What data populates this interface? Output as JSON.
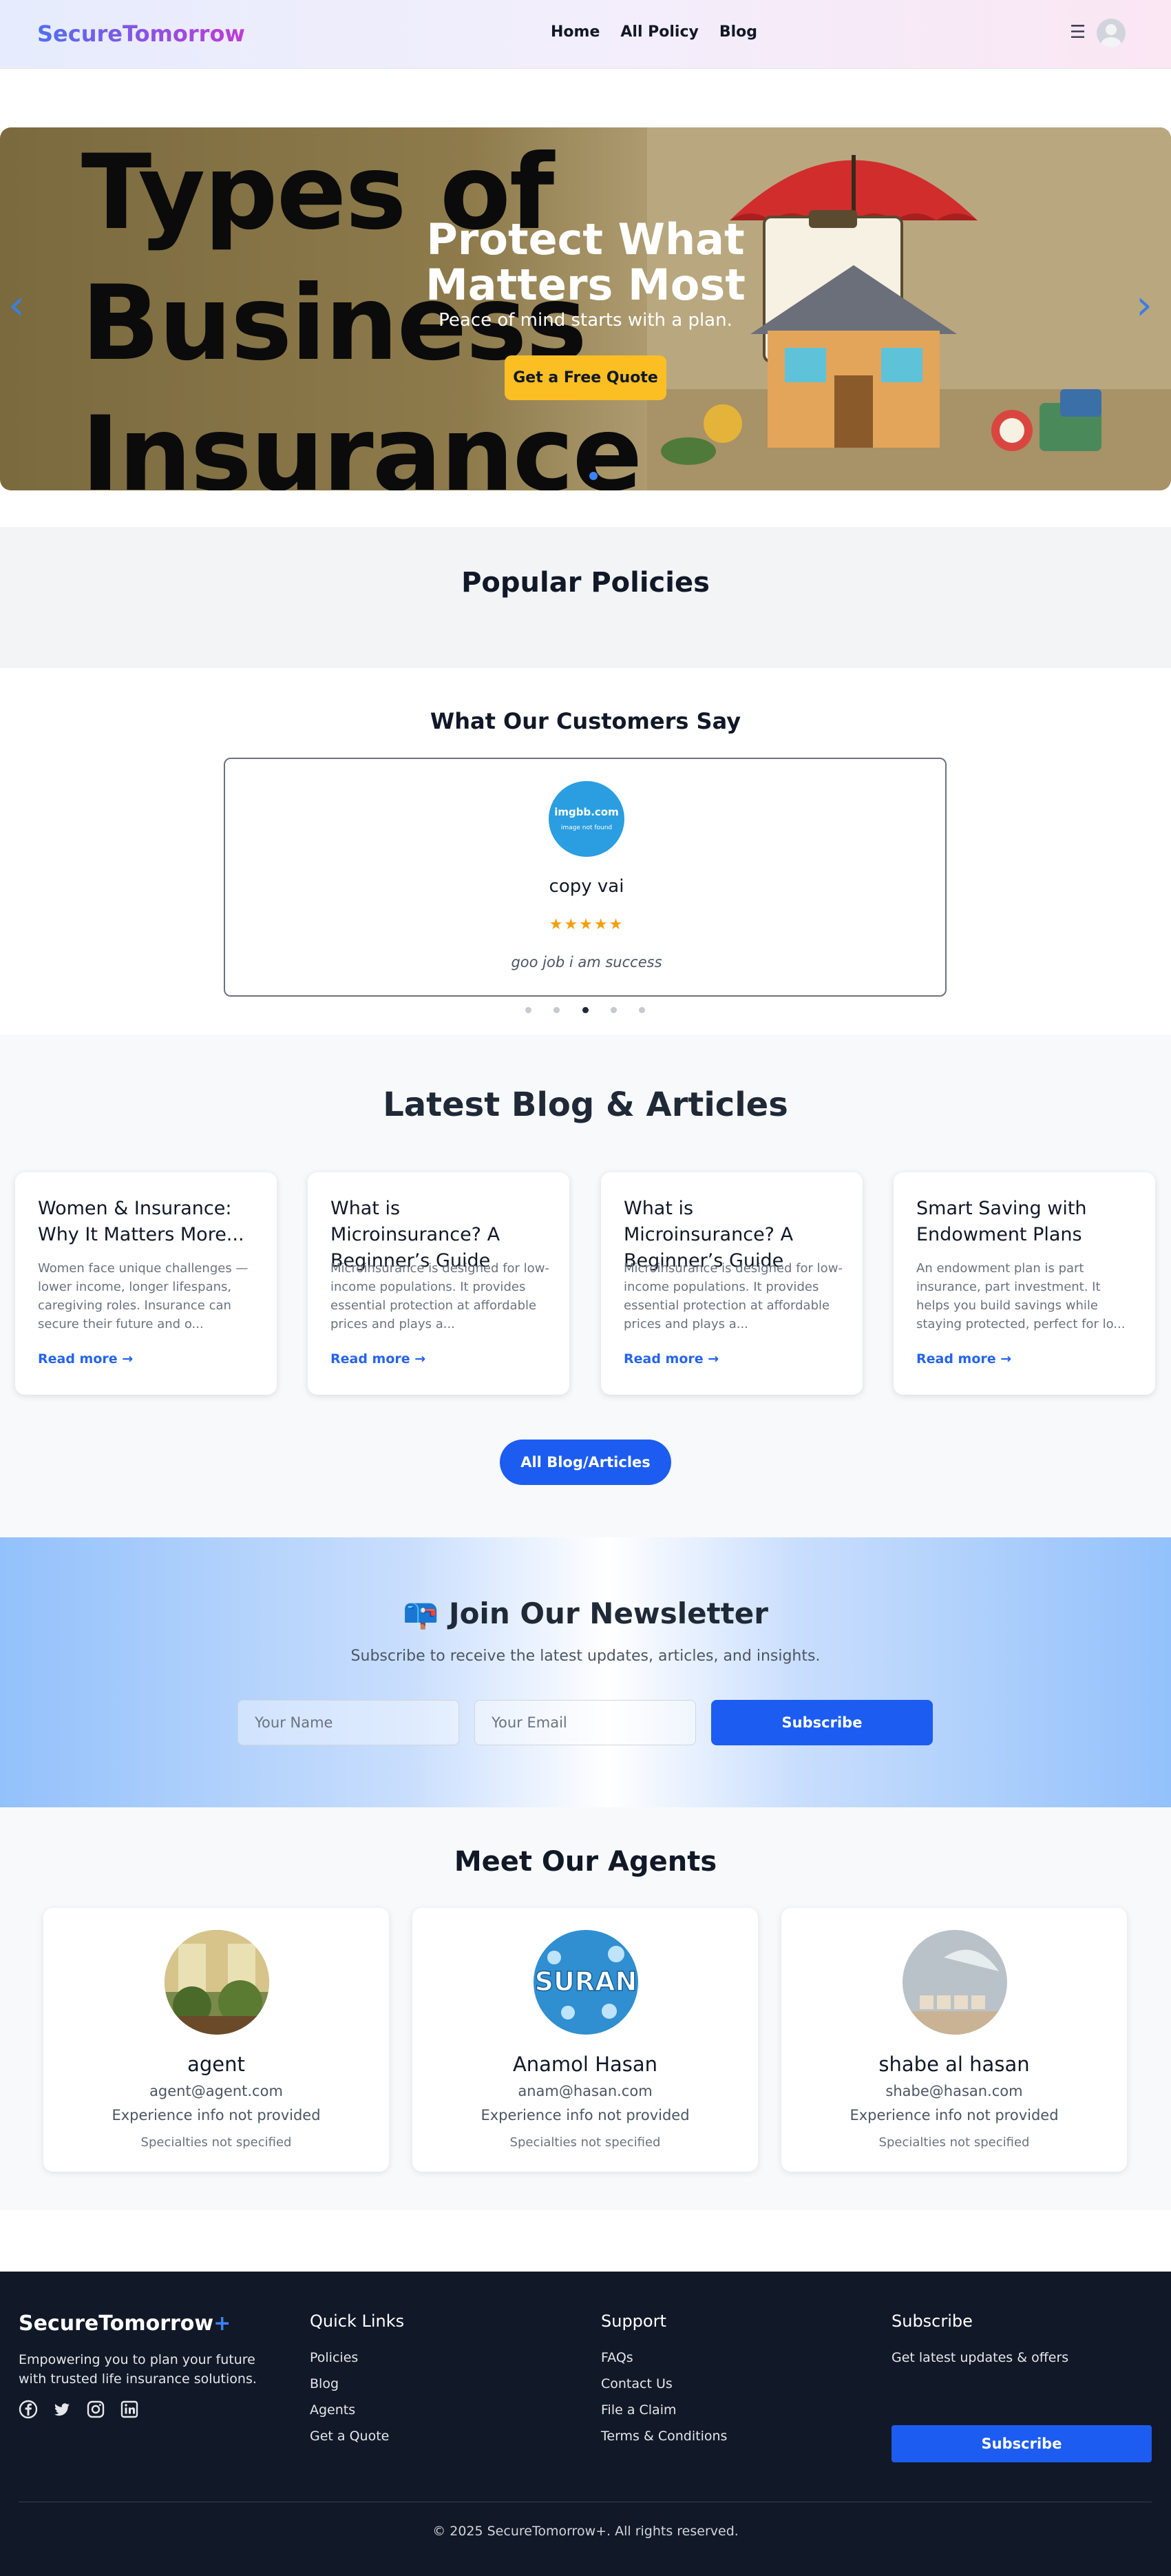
{
  "nav": {
    "brand": "SecureTomorrow",
    "links": [
      "Home",
      "All Policy",
      "Blog"
    ],
    "menu_icon": "hamburger-icon",
    "avatar_icon": "user-avatar-icon"
  },
  "hero": {
    "background_text": [
      "Types of",
      "Business",
      "Insurance"
    ],
    "title_line1": "Protect What",
    "title_line2": "Matters Most",
    "subtitle": "Peace of mind starts with a plan.",
    "cta": "Get a Free Quote",
    "prev_icon": "chevron-left-icon",
    "next_icon": "chevron-right-icon",
    "colors": {
      "cta": "#fbbf24",
      "arrows": "#3b7fe0"
    }
  },
  "popular": {
    "heading": "Popular Policies"
  },
  "testimonials": {
    "heading": "What Our Customers Say",
    "avatar_text": "imgbb.com",
    "avatar_subtext": "image not found",
    "name": "copy vai",
    "stars": "★★★★★",
    "text": "goo job i am success",
    "active_dot": 2
  },
  "blog": {
    "heading": "Latest Blog & Articles",
    "read_more": "Read more →",
    "posts": [
      {
        "title": "Women & Insurance: Why It Matters More...",
        "excerpt": "Women face unique challenges — lower income, longer lifespans, caregiving roles. Insurance can secure their future and o..."
      },
      {
        "title": "What is Microinsurance? A Beginner’s Guide",
        "excerpt": "Microinsurance is designed for low-income populations. It provides essential protection at affordable prices and plays a..."
      },
      {
        "title": "What is Microinsurance? A Beginner’s Guide",
        "excerpt": "Microinsurance is designed for low-income populations. It provides essential protection at affordable prices and plays a..."
      },
      {
        "title": "Smart Saving with Endowment Plans",
        "excerpt": "An endowment plan is part insurance, part investment. It helps you build savings while staying protected, perfect for lo..."
      }
    ],
    "all_button": "All Blog/Articles"
  },
  "newsletter": {
    "icon": "📪",
    "heading": "Join Our Newsletter",
    "subtitle": "Subscribe to receive the latest updates, articles, and insights.",
    "name_placeholder": "Your Name",
    "email_placeholder": "Your Email",
    "button": "Subscribe"
  },
  "agents": {
    "heading": "Meet Our Agents",
    "photo_text": "SURAN",
    "list": [
      {
        "name": "agent",
        "email": "agent@agent.com",
        "experience": "Experience info not provided",
        "specialties": "Specialties not specified"
      },
      {
        "name": "Anamol Hasan",
        "email": "anam@hasan.com",
        "experience": "Experience info not provided",
        "specialties": "Specialties not specified"
      },
      {
        "name": "shabe al hasan",
        "email": "shabe@hasan.com",
        "experience": "Experience info not provided",
        "specialties": "Specialties not specified"
      }
    ]
  },
  "footer": {
    "brand": "SecureTomorrow",
    "brand_plus": "+",
    "description": "Empowering you to plan your future with trusted life insurance solutions.",
    "social_icons": [
      "facebook-icon",
      "twitter-icon",
      "instagram-icon",
      "linkedin-icon"
    ],
    "quick_links_title": "Quick Links",
    "quick_links": [
      "Policies",
      "Blog",
      "Agents",
      "Get a Quote"
    ],
    "support_title": "Support",
    "support_links": [
      "FAQs",
      "Contact Us",
      "File a Claim",
      "Terms & Conditions"
    ],
    "subscribe_title": "Subscribe",
    "subscribe_text": "Get latest updates & offers",
    "subscribe_button": "Subscribe",
    "copyright": "© 2025 SecureTomorrow+. All rights reserved."
  }
}
